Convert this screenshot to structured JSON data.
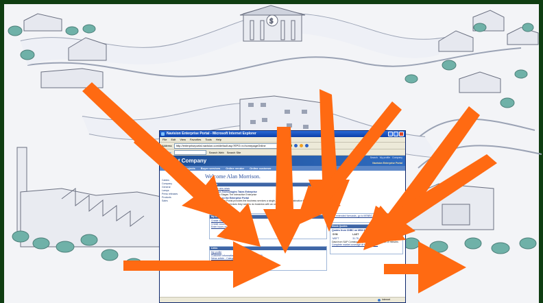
{
  "window": {
    "title": "Navision Enterprise Portal - Microsoft Internet Explorer",
    "menu": [
      "File",
      "Edit",
      "View",
      "Favorites",
      "Tools",
      "Help"
    ],
    "address_label": "Address",
    "address_value": "http://enterpriseportal.navision.com/default.asp?EPO=n=homepageOnline",
    "google_label": "Google",
    "search_web": "Search Web",
    "search_site": "Search Site"
  },
  "portal": {
    "company": "Bright Company",
    "top_links": [
      "Search",
      "My profile",
      "Company"
    ],
    "brand": "Navision Enterprise Portal",
    "nav": [
      "Projects",
      "Buyer services",
      "Online vendor",
      "Online customer"
    ],
    "welcome": "Welcome Alan Morrison.",
    "left_nav": [
      "Cables",
      "Company",
      "General",
      "Lamps",
      "Press releases",
      "Products",
      "Sales"
    ],
    "news": {
      "header": "News",
      "items": [
        "Create new news",
        "Navision Technologies Takes Enterprise",
        "Navision Stages The Interactive Enterprise",
        "Welcome to the Enterprise Portal",
        "An Enterprise Portal provides the business services a single, personalized destination for the key information and services they need to do business with an organization."
      ]
    },
    "tasks": {
      "header": "My frequent Tasks",
      "items": [
        "Create sales order",
        "Create customer",
        "Enter hours on a project"
      ]
    },
    "links": {
      "header": "Links",
      "items": [
        "My profile",
        "Customer information - Customer account: 4689",
        "News article - Category - Company"
      ]
    },
    "forecast": {
      "text": "For extended forecasts, go to MSNBC.com"
    },
    "stock": {
      "header": "Stock Quotes",
      "subtitle": "Quotes from CNBC on MSN Money",
      "columns": [
        "SYM",
        "LAST",
        "CHANGE"
      ],
      "rows": [
        [
          "MSFT",
          "31.75",
          "1.03"
        ]
      ],
      "note": "Data from S&P Comstock - quotes delayed at least 20 minutes",
      "link": "Complete market coverage at MSNBC.com"
    }
  },
  "status": {
    "zone": "Internet"
  },
  "colors": {
    "arrow": "#ff6a12",
    "background": "#0f3d12",
    "ie_title": "#0b3ea8"
  }
}
